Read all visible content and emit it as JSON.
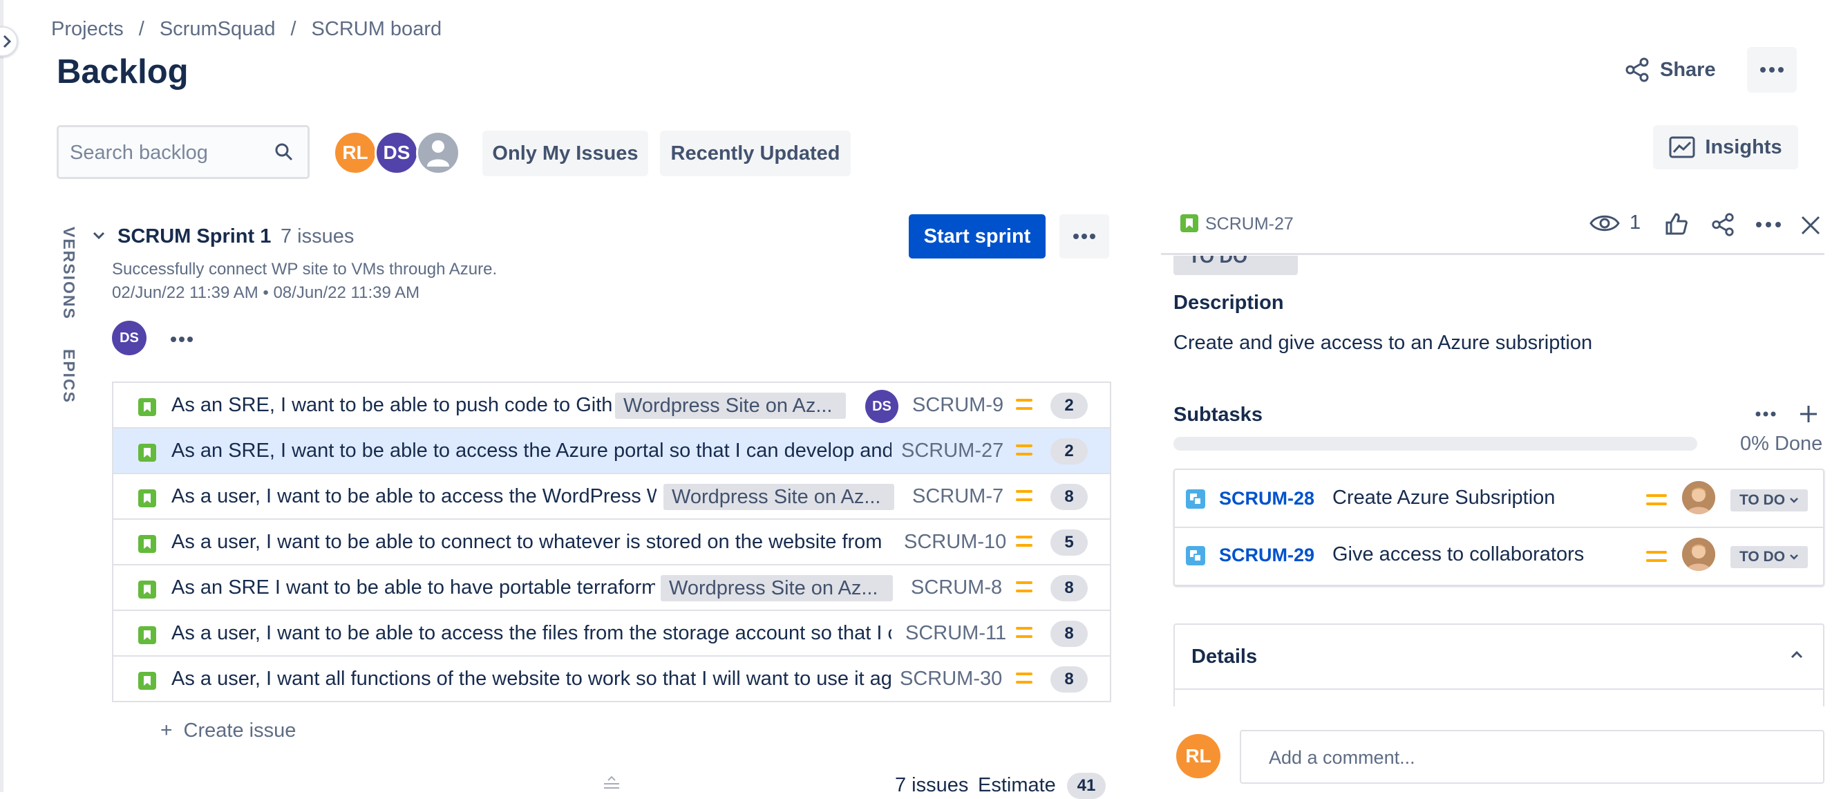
{
  "breadcrumbs": [
    "Projects",
    "ScrumSquad",
    "SCRUM board"
  ],
  "breadcrumb_sep": "/",
  "page_title": "Backlog",
  "header": {
    "share_label": "Share"
  },
  "search": {
    "placeholder": "Search backlog"
  },
  "avatars": [
    {
      "initials": "RL",
      "color": "#f79232"
    },
    {
      "initials": "DS",
      "color": "#5243aa"
    },
    {
      "initials": "",
      "color": "#a5adba"
    }
  ],
  "filters": {
    "only_my_issues": "Only My Issues",
    "recently_updated": "Recently Updated"
  },
  "insights_label": "Insights",
  "side_tabs": {
    "versions": "VERSIONS",
    "epics": "EPICS"
  },
  "sprint": {
    "name": "SCRUM Sprint 1",
    "issue_count": "7 issues",
    "goal": "Successfully connect WP site to VMs through Azure.",
    "dates": "02/Jun/22 11:39 AM  •  08/Jun/22 11:39 AM",
    "assignee_initials": "DS",
    "start_label": "Start sprint"
  },
  "issues": [
    {
      "summary": "As an SRE, I want to be able to push code to Gith",
      "epic": "Wordpress Site on Az...",
      "assignee": "DS",
      "key": "SCRUM-9",
      "estimate": "2"
    },
    {
      "summary": "As an SRE, I want to be able to access the Azure portal so that I can develop and",
      "epic": "",
      "assignee": "",
      "key": "SCRUM-27",
      "estimate": "2"
    },
    {
      "summary": "As a user, I want to be able to access the WordPress W",
      "epic": "Wordpress Site on Az...",
      "assignee": "",
      "key": "SCRUM-7",
      "estimate": "8"
    },
    {
      "summary": "As a user, I want to be able to connect to whatever is stored on the website from t",
      "epic": "",
      "assignee": "",
      "key": "SCRUM-10",
      "estimate": "5"
    },
    {
      "summary": "As an SRE I want to be able to have portable terraform",
      "epic": "Wordpress Site on Az...",
      "assignee": "",
      "key": "SCRUM-8",
      "estimate": "8"
    },
    {
      "summary": "As a user, I want to be able to access the files from the storage account so that I c",
      "epic": "",
      "assignee": "",
      "key": "SCRUM-11",
      "estimate": "8"
    },
    {
      "summary": "As a user, I want all functions of the website to work so that I will want to use it ag",
      "epic": "",
      "assignee": "",
      "key": "SCRUM-30",
      "estimate": "8"
    }
  ],
  "create_issue_label": "Create issue",
  "footer": {
    "issue_count": "7 issues",
    "estimate_label": "Estimate",
    "estimate_total": "41"
  },
  "detail_panel": {
    "issue_key": "SCRUM-27",
    "watch_count": "1",
    "status_label": "TO DO",
    "description_heading": "Description",
    "description": "Create and give access to an Azure subsription",
    "subtasks_heading": "Subtasks",
    "subtasks_progress": 0,
    "subtasks_progress_label": "0% Done",
    "subtasks": [
      {
        "key": "SCRUM-28",
        "summary": "Create Azure Subsription",
        "status": "TO DO"
      },
      {
        "key": "SCRUM-29",
        "summary": "Give access to collaborators",
        "status": "TO DO"
      }
    ],
    "details_heading": "Details",
    "comment_placeholder": "Add a comment...",
    "comment_avatar_initials": "RL"
  },
  "colors": {
    "primary": "#0052cc",
    "story_green": "#63ba3c",
    "priority_medium": "#ffab00",
    "selected_row": "#deebff"
  }
}
